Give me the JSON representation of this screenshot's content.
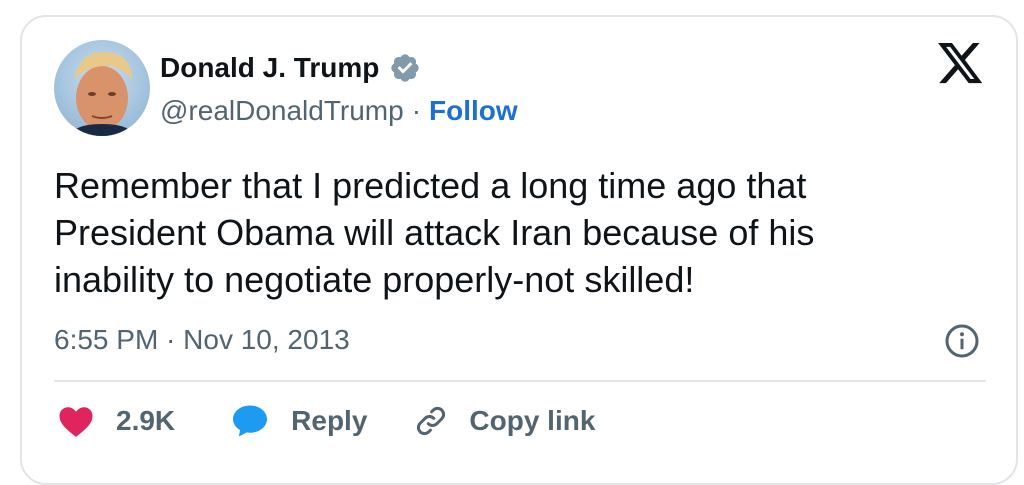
{
  "author": {
    "name": "Donald J. Trump",
    "handle": "@realDonaldTrump",
    "separator": "·",
    "follow_label": "Follow",
    "verified_badge_icon": "verified-badge-icon",
    "avatar_icon": "avatar-photo"
  },
  "brand": {
    "logo_icon": "x-logo-icon"
  },
  "tweet": {
    "lines": [
      "Remember that I predicted a long time ago that",
      "President Obama will attack Iran because of his",
      "inability to negotiate properly-not skilled!"
    ],
    "timestamp": "6:55 PM · Nov 10, 2013",
    "info_icon": "info-icon"
  },
  "actions": {
    "like_count": "2.9K",
    "like_icon": "heart-icon",
    "reply_label": "Reply",
    "reply_icon": "speech-bubble-icon",
    "copy_label": "Copy link",
    "copy_icon": "link-icon"
  },
  "colors": {
    "text": "#0f1419",
    "muted": "#536471",
    "follow": "#1d6fd6",
    "like": "#e0245e",
    "reply": "#1d9bf0",
    "border": "#e1e4e8",
    "verified": "#829aab"
  }
}
